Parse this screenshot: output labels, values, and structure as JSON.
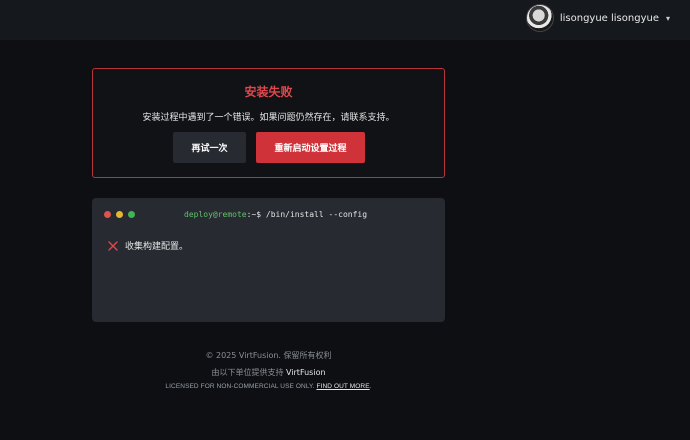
{
  "header": {
    "user_name": "lisongyue lisongyue",
    "caret_icon": "chevron-down-icon"
  },
  "error": {
    "title": "安装失败",
    "message": "安装过程中遇到了一个错误。如果问题仍然存在，请联系支持。",
    "retry_label": "再试一次",
    "restart_label": "重新启动设置过程"
  },
  "terminal": {
    "host": "deploy@remote",
    "prompt_path": ":~$ ",
    "command": "/bin/install --config",
    "steps": [
      {
        "status": "failed",
        "icon": "x-icon",
        "text": "收集构建配置。"
      }
    ]
  },
  "footer": {
    "copyright": "© 2025 VirtFusion. 保留所有权利",
    "powered_prefix": "由以下单位提供支持 ",
    "powered_brand": "VirtFusion",
    "license_text": "LICENSED FOR NON-COMMERCIAL USE ONLY. ",
    "license_link": "FIND OUT MORE",
    "license_suffix": "."
  },
  "colors": {
    "accent_red": "#d0323a",
    "terminal_host_green": "#5fc36a",
    "background": "#0d0f13"
  }
}
